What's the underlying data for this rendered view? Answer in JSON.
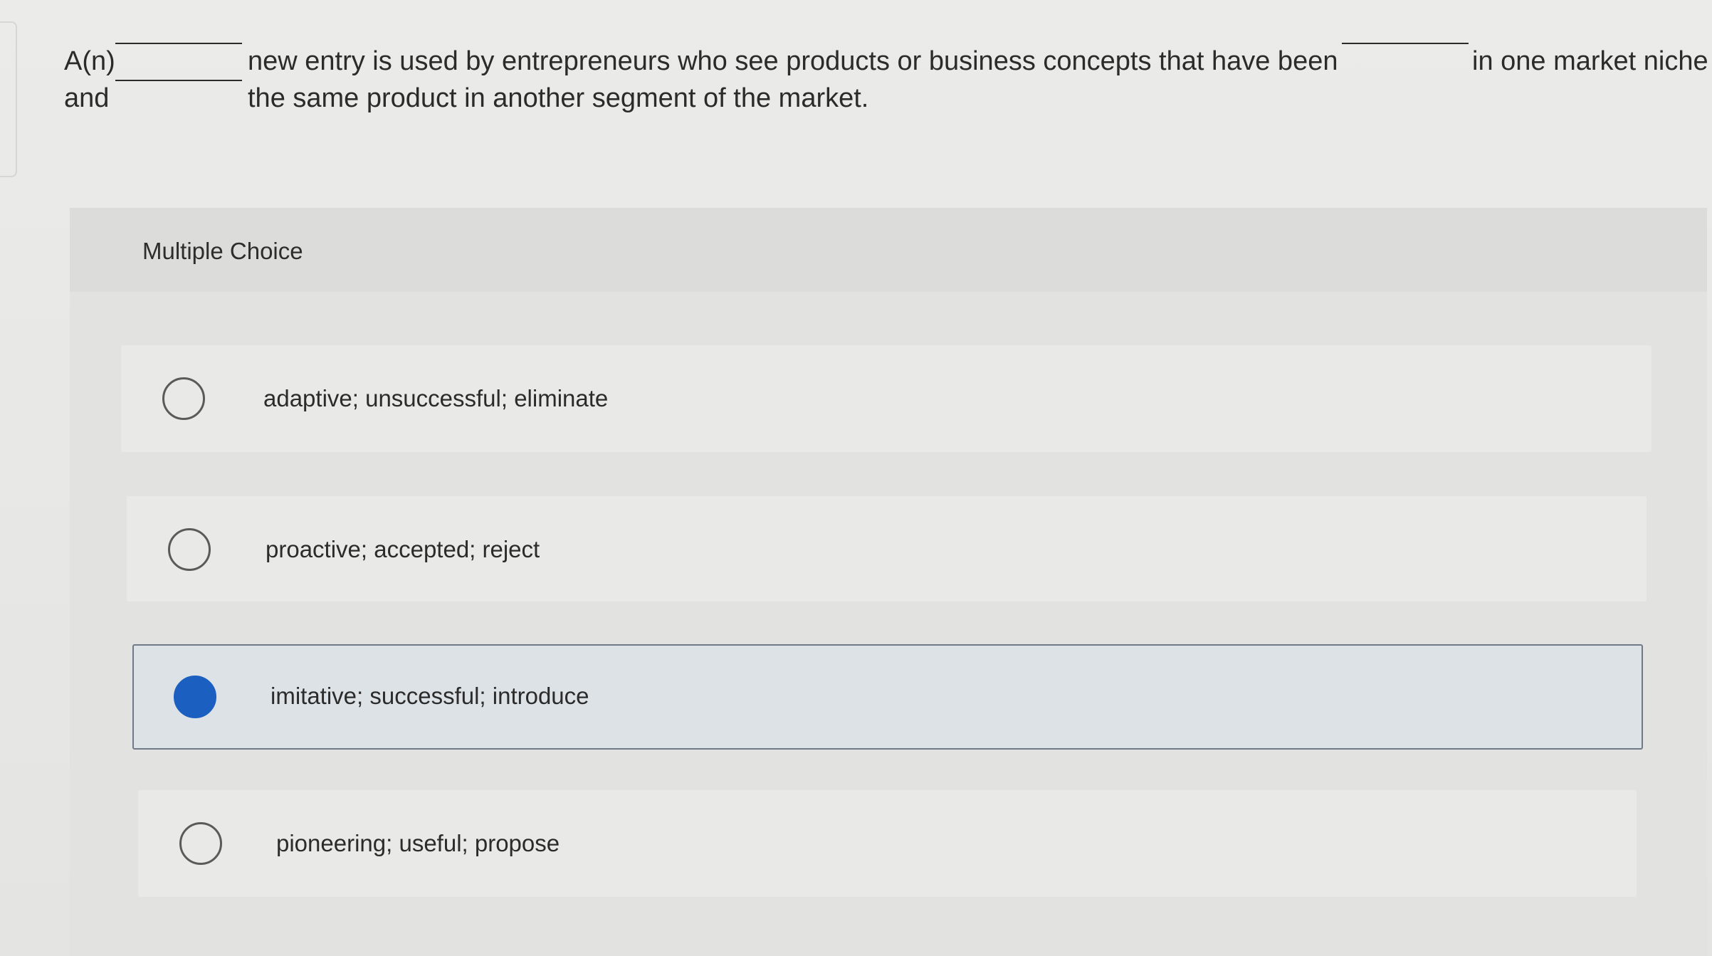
{
  "question": {
    "line1_start": "A(n)",
    "line1_middle": "new entry is used by entrepreneurs who see products or business concepts that have been",
    "line1_end": "in one market niche",
    "line2_start": "and",
    "line2_end": "the same product in another segment of the market."
  },
  "multiple_choice": {
    "title": "Multiple Choice",
    "options": [
      {
        "label": "adaptive; unsuccessful; eliminate",
        "selected": false
      },
      {
        "label": "proactive; accepted; reject",
        "selected": false
      },
      {
        "label": "imitative; successful; introduce",
        "selected": true
      },
      {
        "label": "pioneering; useful; propose",
        "selected": false
      }
    ]
  },
  "colors": {
    "selected_radio": "#1b5fc1",
    "selected_border": "#6f7a86"
  }
}
